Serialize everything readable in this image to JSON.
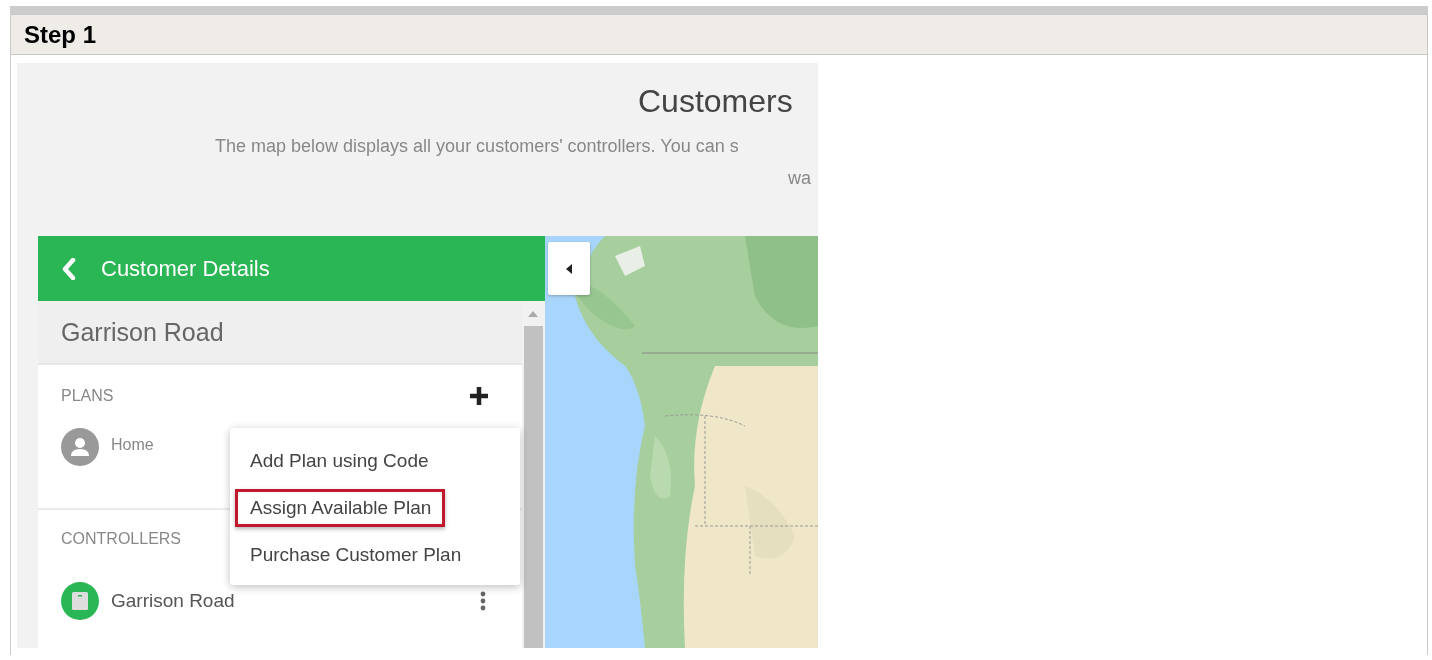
{
  "section": {
    "title": "Step 1"
  },
  "page": {
    "title": "Customers",
    "description_lines": [
      "The map below displays all your customers' controllers. You can s",
      "wa"
    ]
  },
  "panel": {
    "title": "Customer Details",
    "customer_name": "Garrison Road",
    "plans": {
      "heading": "PLANS",
      "items": [
        {
          "name": "Home"
        }
      ]
    },
    "controllers": {
      "heading": "CONTROLLERS",
      "items": [
        {
          "name": "Garrison Road"
        }
      ]
    }
  },
  "menu": {
    "items": [
      {
        "label": "Add Plan using Code",
        "selected": false
      },
      {
        "label": "Assign Available Plan",
        "selected": true
      },
      {
        "label": "Purchase Customer Plan",
        "selected": false
      }
    ]
  }
}
